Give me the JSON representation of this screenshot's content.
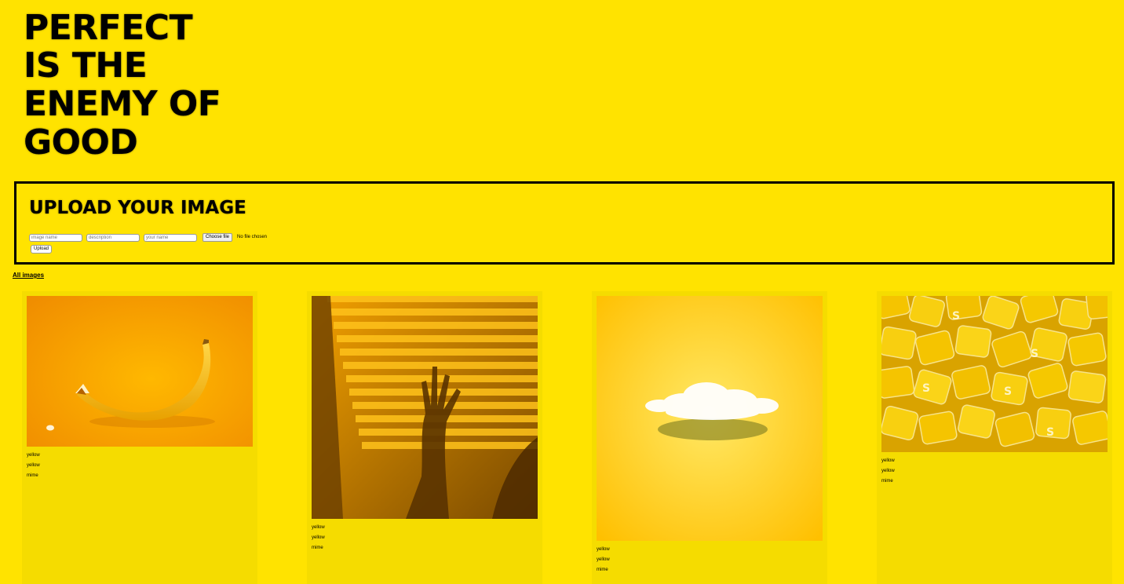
{
  "logo": {
    "lines": [
      "PERFECT",
      "IS THE",
      "ENEMY OF",
      "GOOD"
    ]
  },
  "upload": {
    "title": "UPLOAD YOUR IMAGE",
    "name_placeholder": "image name",
    "description_placeholder": "description",
    "author_placeholder": "your name",
    "file_button": "Choose file",
    "file_status": "No file chosen",
    "submit": "Upload"
  },
  "nav": {
    "all_images": "All images"
  },
  "gallery": {
    "cards": [
      {
        "image": "banana-photo",
        "title": "yellow",
        "description": "yellow",
        "author": "mime"
      },
      {
        "image": "blinds-shadow-photo",
        "title": "yellow",
        "description": "yellow",
        "author": "mime"
      },
      {
        "image": "cloud-photo",
        "title": "yellow",
        "description": "yellow",
        "author": "mime"
      },
      {
        "image": "candy-photo",
        "title": "yellow",
        "description": "yellow",
        "author": "mime"
      }
    ]
  },
  "colors": {
    "background": "#ffe300",
    "card": "#f5dc00",
    "border": "#000000"
  }
}
